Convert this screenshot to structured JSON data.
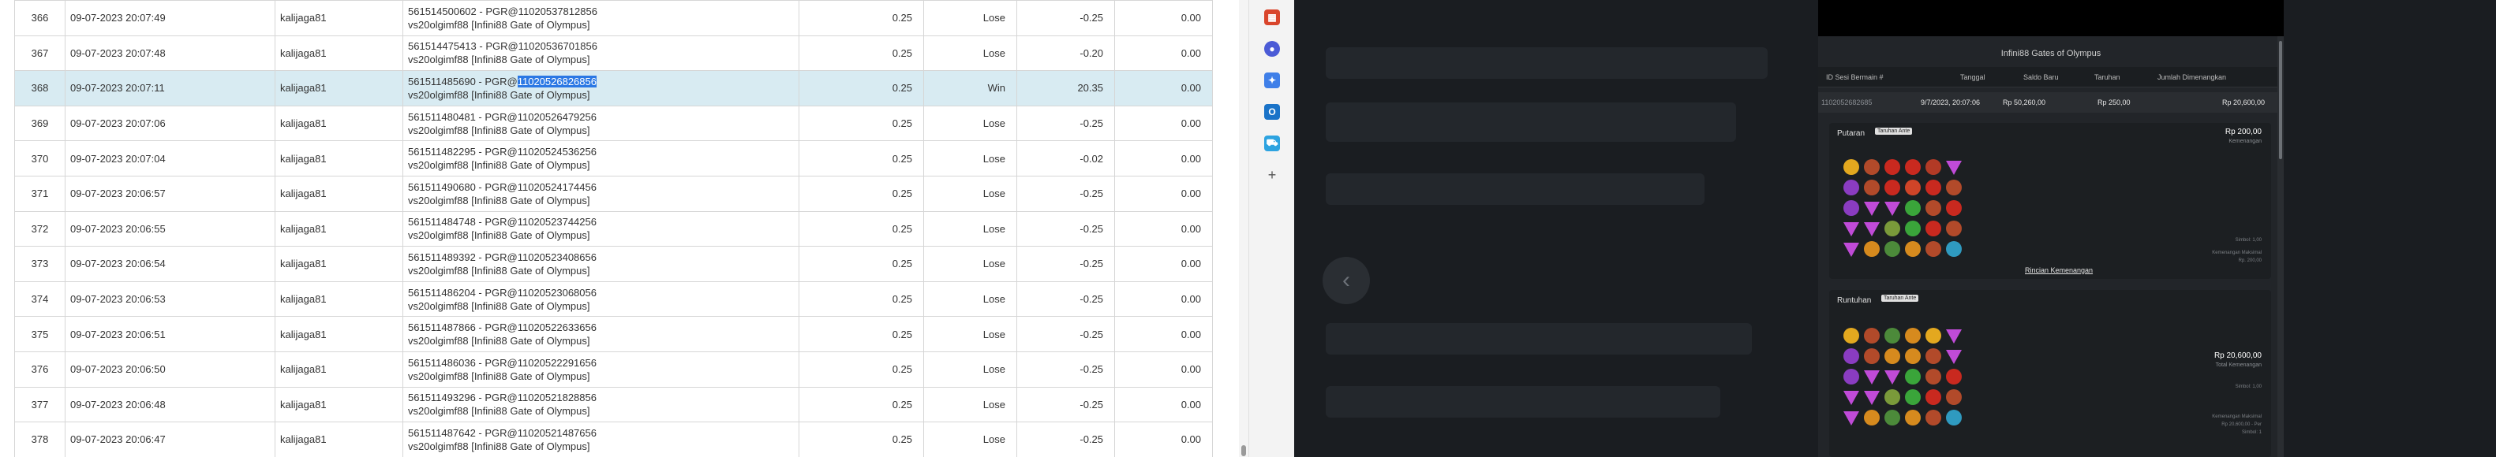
{
  "table": {
    "rows": [
      {
        "no": "366",
        "time": "09-07-2023 20:07:49",
        "user": "kalijaga81",
        "desc1": "561514500602 - PGR@11020537812856",
        "desc2": "vs20olgimf88 [Infini88 Gate of Olympus]",
        "amount": "0.25",
        "result": "Lose",
        "win": "-0.25",
        "balance": "0.00"
      },
      {
        "no": "367",
        "time": "09-07-2023 20:07:48",
        "user": "kalijaga81",
        "desc1": "561514475413 - PGR@11020536701856",
        "desc2": "vs20olgimf88 [Infini88 Gate of Olympus]",
        "amount": "0.25",
        "result": "Lose",
        "win": "-0.20",
        "balance": "0.00"
      },
      {
        "no": "368",
        "time": "09-07-2023 20:07:11",
        "user": "kalijaga81",
        "desc1a": "561511485690 - PGR@",
        "desc1b": "11020526826856",
        "desc2": "vs20olgimf88 [Infini88 Gate of Olympus]",
        "amount": "0.25",
        "result": "Win",
        "win": "20.35",
        "balance": "0.00"
      },
      {
        "no": "369",
        "time": "09-07-2023 20:07:06",
        "user": "kalijaga81",
        "desc1": "561511480481 - PGR@11020526479256",
        "desc2": "vs20olgimf88 [Infini88 Gate of Olympus]",
        "amount": "0.25",
        "result": "Lose",
        "win": "-0.25",
        "balance": "0.00"
      },
      {
        "no": "370",
        "time": "09-07-2023 20:07:04",
        "user": "kalijaga81",
        "desc1": "561511482295 - PGR@11020524536256",
        "desc2": "vs20olgimf88 [Infini88 Gate of Olympus]",
        "amount": "0.25",
        "result": "Lose",
        "win": "-0.02",
        "balance": "0.00"
      },
      {
        "no": "371",
        "time": "09-07-2023 20:06:57",
        "user": "kalijaga81",
        "desc1": "561511490680 - PGR@11020524174456",
        "desc2": "vs20olgimf88 [Infini88 Gate of Olympus]",
        "amount": "0.25",
        "result": "Lose",
        "win": "-0.25",
        "balance": "0.00"
      },
      {
        "no": "372",
        "time": "09-07-2023 20:06:55",
        "user": "kalijaga81",
        "desc1": "561511484748 - PGR@11020523744256",
        "desc2": "vs20olgimf88 [Infini88 Gate of Olympus]",
        "amount": "0.25",
        "result": "Lose",
        "win": "-0.25",
        "balance": "0.00"
      },
      {
        "no": "373",
        "time": "09-07-2023 20:06:54",
        "user": "kalijaga81",
        "desc1": "561511489392 - PGR@11020523408656",
        "desc2": "vs20olgimf88 [Infini88 Gate of Olympus]",
        "amount": "0.25",
        "result": "Lose",
        "win": "-0.25",
        "balance": "0.00"
      },
      {
        "no": "374",
        "time": "09-07-2023 20:06:53",
        "user": "kalijaga81",
        "desc1": "561511486204 - PGR@11020523068056",
        "desc2": "vs20olgimf88 [Infini88 Gate of Olympus]",
        "amount": "0.25",
        "result": "Lose",
        "win": "-0.25",
        "balance": "0.00"
      },
      {
        "no": "375",
        "time": "09-07-2023 20:06:51",
        "user": "kalijaga81",
        "desc1": "561511487866 - PGR@11020522633656",
        "desc2": "vs20olgimf88 [Infini88 Gate of Olympus]",
        "amount": "0.25",
        "result": "Lose",
        "win": "-0.25",
        "balance": "0.00"
      },
      {
        "no": "376",
        "time": "09-07-2023 20:06:50",
        "user": "kalijaga81",
        "desc1": "561511486036 - PGR@11020522291656",
        "desc2": "vs20olgimf88 [Infini88 Gate of Olympus]",
        "amount": "0.25",
        "result": "Lose",
        "win": "-0.25",
        "balance": "0.00"
      },
      {
        "no": "377",
        "time": "09-07-2023 20:06:48",
        "user": "kalijaga81",
        "desc1": "561511493296 - PGR@11020521828856",
        "desc2": "vs20olgimf88 [Infini88 Gate of Olympus]",
        "amount": "0.25",
        "result": "Lose",
        "win": "-0.25",
        "balance": "0.00"
      },
      {
        "no": "378",
        "time": "09-07-2023 20:06:47",
        "user": "kalijaga81",
        "desc1": "561511487642 - PGR@11020521487656",
        "desc2": "vs20olgimf88 [Infini88 Gate of Olympus]",
        "amount": "0.25",
        "result": "Lose",
        "win": "-0.25",
        "balance": "0.00"
      }
    ]
  },
  "sidebar": {
    "icons": [
      "toolbox-icon",
      "person-icon",
      "puzzle-icon",
      "outlook-icon",
      "cart-icon",
      "plus-icon"
    ]
  },
  "panel": {
    "title": "Infini88 Gates of Olympus",
    "head": {
      "round_id": "ID Sesi Bermain #",
      "date": "Tanggal",
      "start_balance": "Saldo Baru",
      "bet": "Taruhan",
      "total_win": "Jumlah Dimenangkan"
    },
    "row": {
      "round_id": "1102052682685",
      "date": "9/7/2023, 20:07:06",
      "start_balance": "Rp 50,260,00",
      "bet": "Rp 250,00",
      "total_win": "Rp 20,600,00"
    },
    "spin": {
      "label": "Putaran",
      "badge": "Taruhan Ante",
      "amount": "Rp 200,00",
      "sub": "Kemenangan",
      "note1": "Simbol: 1,00",
      "note2": "Kemenangan Maksimal",
      "note3": "Rp. 200,00",
      "link": "Rincian Kemenangan"
    },
    "tumble": {
      "label": "Runtuhan",
      "badge": "Taruhan Ante",
      "amount": "Rp 20,600,00",
      "sub": "Total Kemenangan",
      "note1": "Simbol: 1,00",
      "note2": "Kemenangan Maksimal",
      "note3": "Rp 20,600,00 - Per",
      "note4": "Simbol: 1"
    }
  },
  "colors": {
    "lose": "#e53935",
    "win": "#2e9b3c",
    "selected_row": "#d8ebf2"
  }
}
